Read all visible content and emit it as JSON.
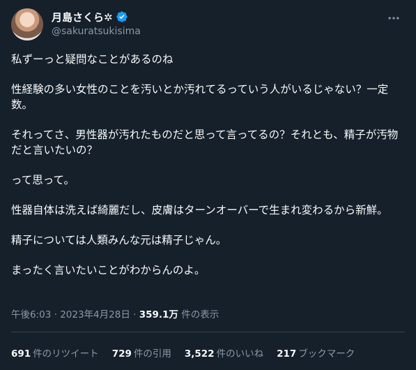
{
  "author": {
    "display_name": "月島さくら✲",
    "handle": "@sakuratsukisima"
  },
  "tweet": {
    "paragraphs": [
      "私ずーっと疑問なことがあるのね",
      "性経験の多い女性のことを汚いとか汚れてるっていう人がいるじゃない？一定数。",
      "それってさ、男性器が汚れたものだと思って言ってるの？それとも、精子が汚物だと言いたいの？",
      "って思って。",
      "性器自体は洗えば綺麗だし、皮膚はターンオーバーで生まれ変わるから新鮮。",
      "精子については人類みんな元は精子じゃん。",
      "まったく言いたいことがわからんのよ。"
    ],
    "timestamp": "午後6:03 · 2023年4月28日",
    "separator": "·",
    "views_count": "359.1万",
    "views_label": "件の表示"
  },
  "stats": [
    {
      "num": "691",
      "label": "件のリツイート"
    },
    {
      "num": "729",
      "label": "件の引用"
    },
    {
      "num": "3,522",
      "label": "件のいいね"
    },
    {
      "num": "217",
      "label": "ブックマーク"
    }
  ],
  "colors": {
    "background": "#15202b",
    "text": "#f7f9f9",
    "muted": "#8b98a5",
    "verified": "#1d9bf0",
    "divider": "#38444d"
  },
  "icons": {
    "verified": "verified-badge-icon",
    "more": "more-options-icon"
  }
}
